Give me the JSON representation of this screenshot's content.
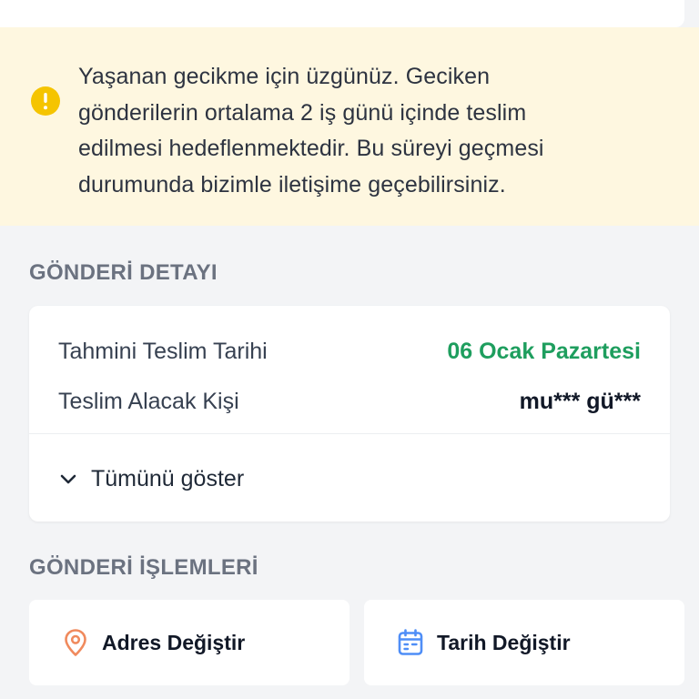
{
  "alert": {
    "icon": "warning-icon",
    "color": "#f5c400",
    "line1": "Yaşanan gecikme için üzgünüz. Geciken",
    "line2": "gönderilerin ortalama 2 iş günü içinde teslim",
    "line3": "edilmesi hedeflenmektedir. Bu süreyi geçmesi",
    "line4": "durumunda bizimle iletişime geçebilirsiniz."
  },
  "details": {
    "section_title": "GÖNDERİ DETAYI",
    "delivery_date_label": "Tahmini Teslim Tarihi",
    "delivery_date_value": "06 Ocak Pazartesi",
    "recipient_label": "Teslim Alacak Kişi",
    "recipient_value": "mu*** gü***",
    "show_all": "Tümünü göster",
    "accent_green": "#1e9e5e"
  },
  "actions": {
    "section_title": "GÖNDERİ İŞLEMLERİ",
    "change_address": "Adres Değiştir",
    "change_address_icon": "location-pin-icon",
    "change_date": "Tarih Değiştir",
    "change_date_icon": "calendar-icon"
  }
}
